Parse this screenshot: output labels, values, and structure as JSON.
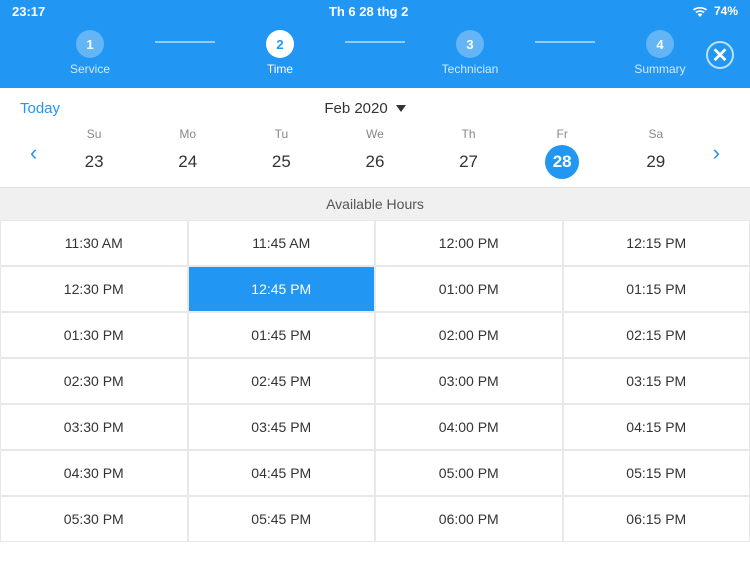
{
  "status_bar": {
    "time": "23:17",
    "day": "Th 6 28 thg 2",
    "wifi_icon": "wifi",
    "battery": "74%"
  },
  "steps": [
    {
      "number": "1",
      "label": "Service",
      "state": "inactive"
    },
    {
      "number": "2",
      "label": "Time",
      "state": "active"
    },
    {
      "number": "3",
      "label": "Technician",
      "state": "inactive"
    },
    {
      "number": "4",
      "label": "Summary",
      "state": "inactive"
    }
  ],
  "close_label": "✕",
  "calendar": {
    "today_label": "Today",
    "month_label": "Feb 2020",
    "prev_arrow": "‹",
    "next_arrow": "›",
    "days": [
      {
        "name": "Su",
        "num": "23",
        "active": false
      },
      {
        "name": "Mo",
        "num": "24",
        "active": false
      },
      {
        "name": "Tu",
        "num": "25",
        "active": false
      },
      {
        "name": "We",
        "num": "26",
        "active": false
      },
      {
        "name": "Th",
        "num": "27",
        "active": false
      },
      {
        "name": "Fr",
        "num": "28",
        "active": true
      },
      {
        "name": "Sa",
        "num": "29",
        "active": false
      }
    ]
  },
  "available_hours_label": "Available Hours",
  "time_slots": [
    {
      "label": "11:30 AM",
      "selected": false
    },
    {
      "label": "11:45 AM",
      "selected": false
    },
    {
      "label": "12:00 PM",
      "selected": false
    },
    {
      "label": "12:15 PM",
      "selected": false
    },
    {
      "label": "12:30 PM",
      "selected": false
    },
    {
      "label": "12:45 PM",
      "selected": true
    },
    {
      "label": "01:00 PM",
      "selected": false
    },
    {
      "label": "01:15 PM",
      "selected": false
    },
    {
      "label": "01:30 PM",
      "selected": false
    },
    {
      "label": "01:45 PM",
      "selected": false
    },
    {
      "label": "02:00 PM",
      "selected": false
    },
    {
      "label": "02:15 PM",
      "selected": false
    },
    {
      "label": "02:30 PM",
      "selected": false
    },
    {
      "label": "02:45 PM",
      "selected": false
    },
    {
      "label": "03:00 PM",
      "selected": false
    },
    {
      "label": "03:15 PM",
      "selected": false
    },
    {
      "label": "03:30 PM",
      "selected": false
    },
    {
      "label": "03:45 PM",
      "selected": false
    },
    {
      "label": "04:00 PM",
      "selected": false
    },
    {
      "label": "04:15 PM",
      "selected": false
    },
    {
      "label": "04:30 PM",
      "selected": false
    },
    {
      "label": "04:45 PM",
      "selected": false
    },
    {
      "label": "05:00 PM",
      "selected": false
    },
    {
      "label": "05:15 PM",
      "selected": false
    },
    {
      "label": "05:30 PM",
      "selected": false
    },
    {
      "label": "05:45 PM",
      "selected": false
    },
    {
      "label": "06:00 PM",
      "selected": false
    },
    {
      "label": "06:15 PM",
      "selected": false
    }
  ]
}
